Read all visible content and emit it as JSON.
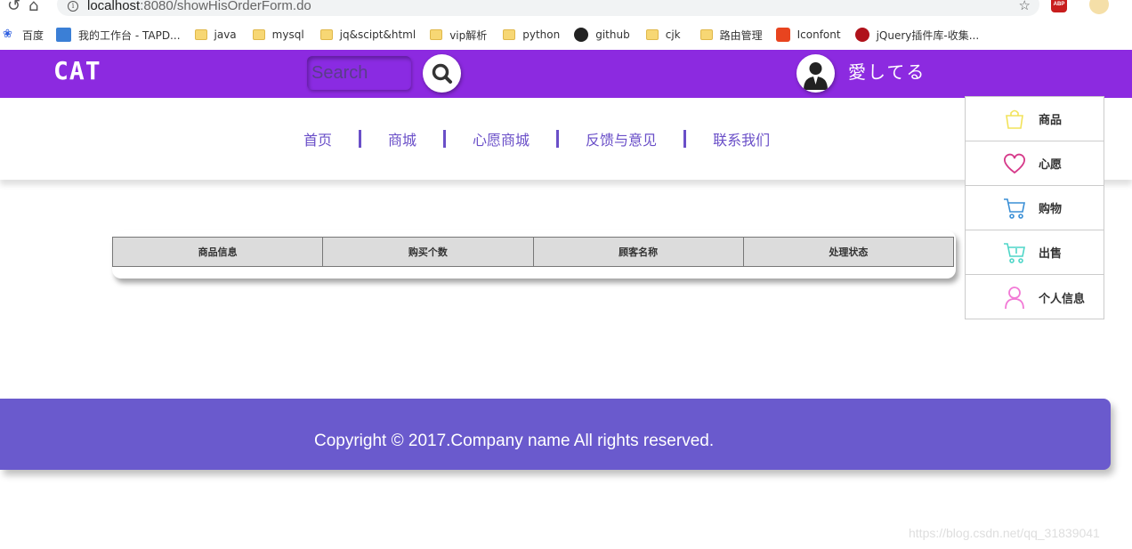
{
  "browser": {
    "url_host": "localhost",
    "url_path": ":8080/showHisOrderForm.do",
    "abp_label": "ABP",
    "bookmarks": [
      {
        "label": "百度",
        "icon": "baidu-paw-icon"
      },
      {
        "label": "我的工作台 - TAPD...",
        "icon": "tapd-icon"
      },
      {
        "label": "java",
        "icon": "folder-icon"
      },
      {
        "label": "mysql",
        "icon": "folder-icon"
      },
      {
        "label": "jq&scipt&html",
        "icon": "folder-icon"
      },
      {
        "label": "vip解析",
        "icon": "folder-icon"
      },
      {
        "label": "python",
        "icon": "folder-icon"
      },
      {
        "label": "github",
        "icon": "github-icon"
      },
      {
        "label": "cjk",
        "icon": "folder-icon"
      },
      {
        "label": "路由管理",
        "icon": "folder-icon"
      },
      {
        "label": "Iconfont",
        "icon": "iconfont-icon"
      },
      {
        "label": "jQuery插件库-收集...",
        "icon": "jquery-icon"
      }
    ]
  },
  "header": {
    "logo": "CAT",
    "search_placeholder": "Search",
    "username": "愛してる",
    "bg_color": "#8c2ae0"
  },
  "nav": {
    "links": [
      "首页",
      "商城",
      "心愿商城",
      "反馈与意见",
      "联系我们"
    ],
    "color": "#6a4fc8"
  },
  "table": {
    "headers": [
      "商品信息",
      "购买个数",
      "顾客名称",
      "处理状态"
    ]
  },
  "side_menu": {
    "items": [
      {
        "label": "商品",
        "icon": "shopping-bag-icon",
        "color": "#f2e35a"
      },
      {
        "label": "心愿",
        "icon": "heart-icon",
        "color": "#d63a8a"
      },
      {
        "label": "购物",
        "icon": "cart-icon",
        "color": "#3a8fd6"
      },
      {
        "label": "出售",
        "icon": "sell-cart-icon",
        "color": "#4fd6c8"
      },
      {
        "label": "个人信息",
        "icon": "user-icon",
        "color": "#f27ad6"
      }
    ]
  },
  "footer": {
    "copyright": "Copyright © 2017.Company name All rights reserved.",
    "bg_color": "#6a5acd"
  },
  "watermark": "https://blog.csdn.net/qq_31839041"
}
